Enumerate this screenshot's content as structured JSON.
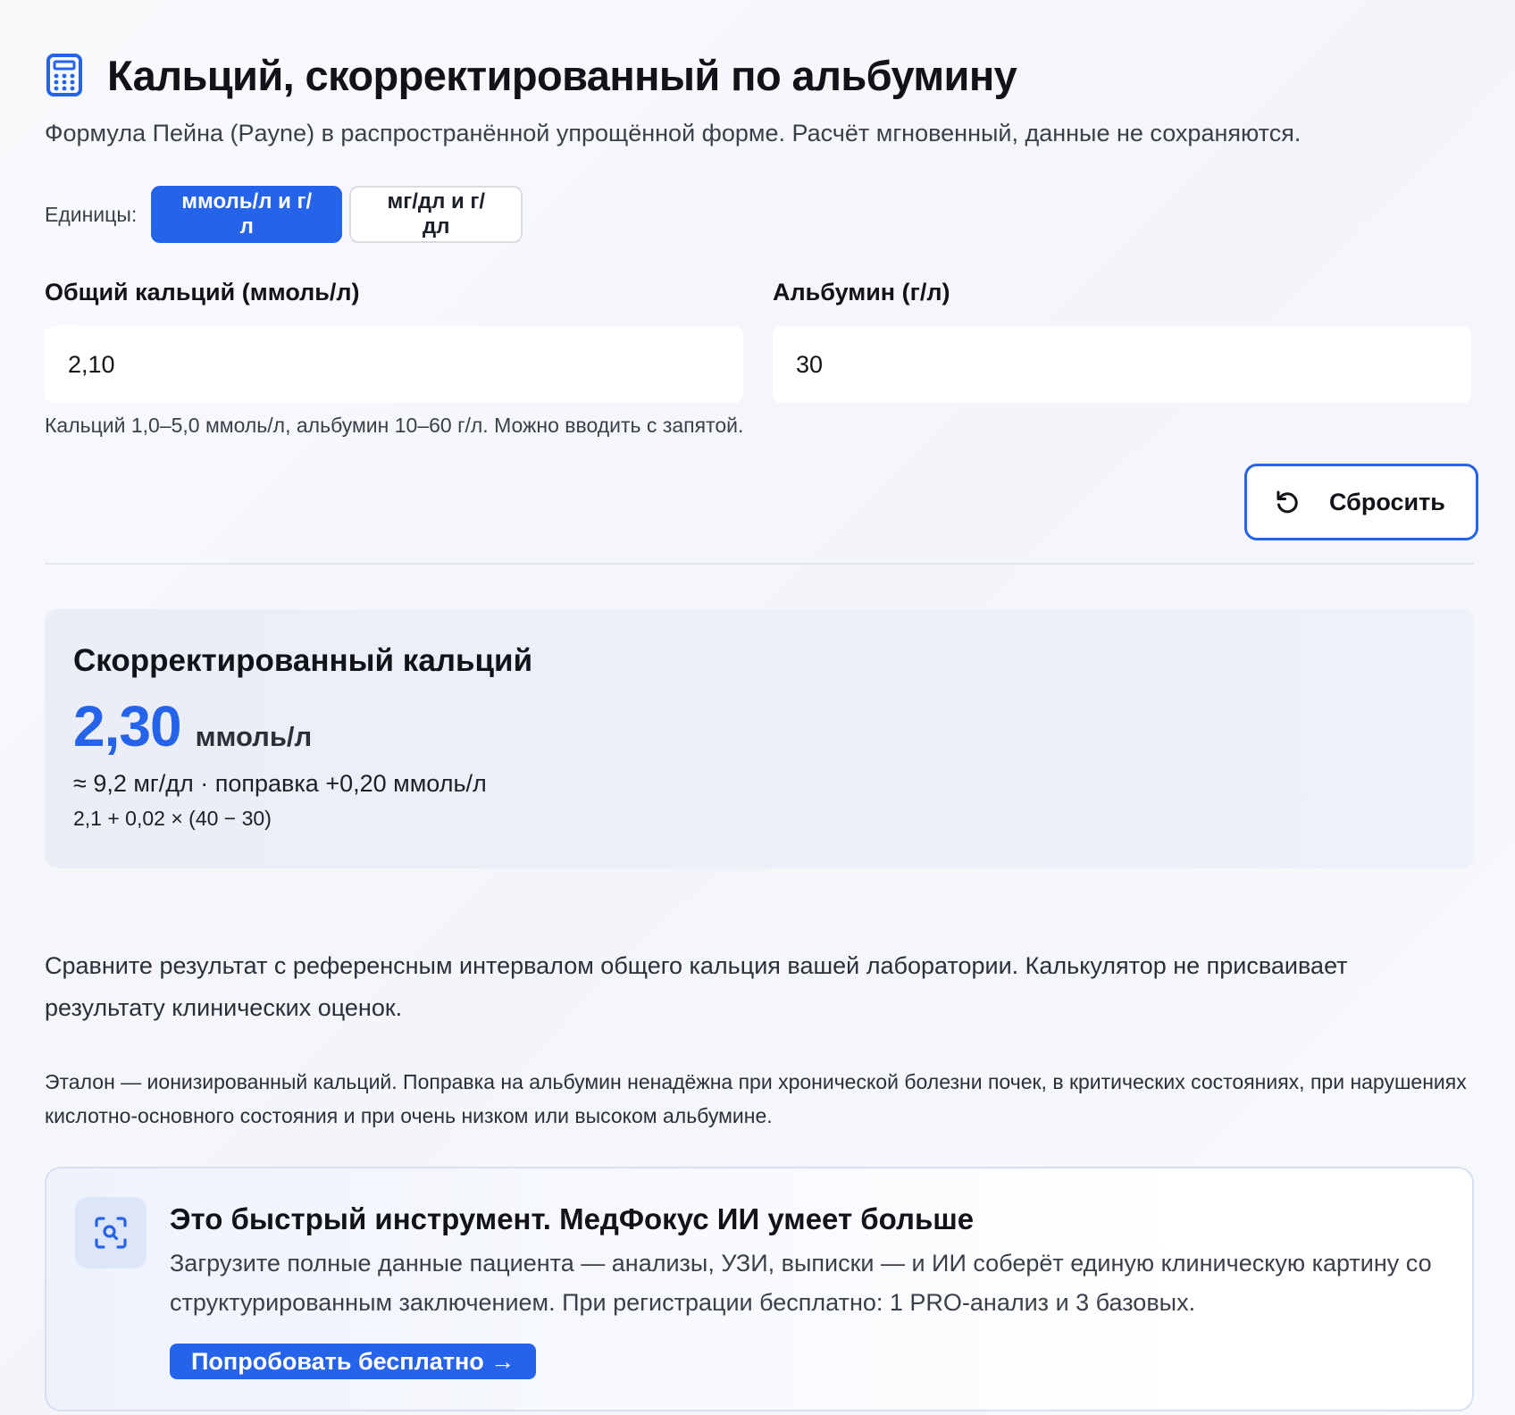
{
  "header": {
    "icon": "calculator-icon",
    "title": "Кальций, скорректированный по альбумину",
    "subtitle": "Формула Пейна (Payne) в распространённой упрощённой форме. Расчёт мгновенный, данные не сохраняются."
  },
  "units": {
    "label": "Единицы:",
    "options": [
      {
        "label": "ммоль/л и г/л",
        "selected": true
      },
      {
        "label": "мг/дл и г/дл",
        "selected": false
      }
    ]
  },
  "inputs": {
    "calcium": {
      "label": "Общий кальций (ммоль/л)",
      "value": "2,10"
    },
    "albumin": {
      "label": "Альбумин (г/л)",
      "value": "30"
    },
    "hint": "Кальций 1,0–5,0 ммоль/л, альбумин 10–60 г/л. Можно вводить с запятой."
  },
  "reset": {
    "label": "Сбросить",
    "icon": "reset-icon"
  },
  "result": {
    "title": "Скорректированный кальций",
    "value": "2,30",
    "unit": "ммоль/л",
    "sub": "≈ 9,2 мг/дл · поправка +0,20 ммоль/л",
    "formula": "2,1 + 0,02 × (40 − 30)"
  },
  "notes": {
    "compare": "Сравните результат с референсным интервалом общего кальция вашей лаборатории. Калькулятор не присваивает результату клинических оценок.",
    "caveat": "Эталон — ионизированный кальций. Поправка на альбумин ненадёжна при хронической болезни почек, в критических состояниях, при нарушениях кислотно-основного состояния и при очень низком или высоком альбумине."
  },
  "promo": {
    "icon": "search-scan-icon",
    "title": "Это быстрый инструмент. МедФокус ИИ умеет больше",
    "text": "Загрузите полные данные пациента — анализы, УЗИ, выписки — и ИИ соберёт единую клиническую картину со структурированным заключением. При регистрации бесплатно: 1 PRO-анализ и 3 базовых.",
    "cta": "Попробовать бесплатно →"
  },
  "colors": {
    "accent": "#2563eb",
    "text": "#111318",
    "muted": "#3a3f4a"
  }
}
